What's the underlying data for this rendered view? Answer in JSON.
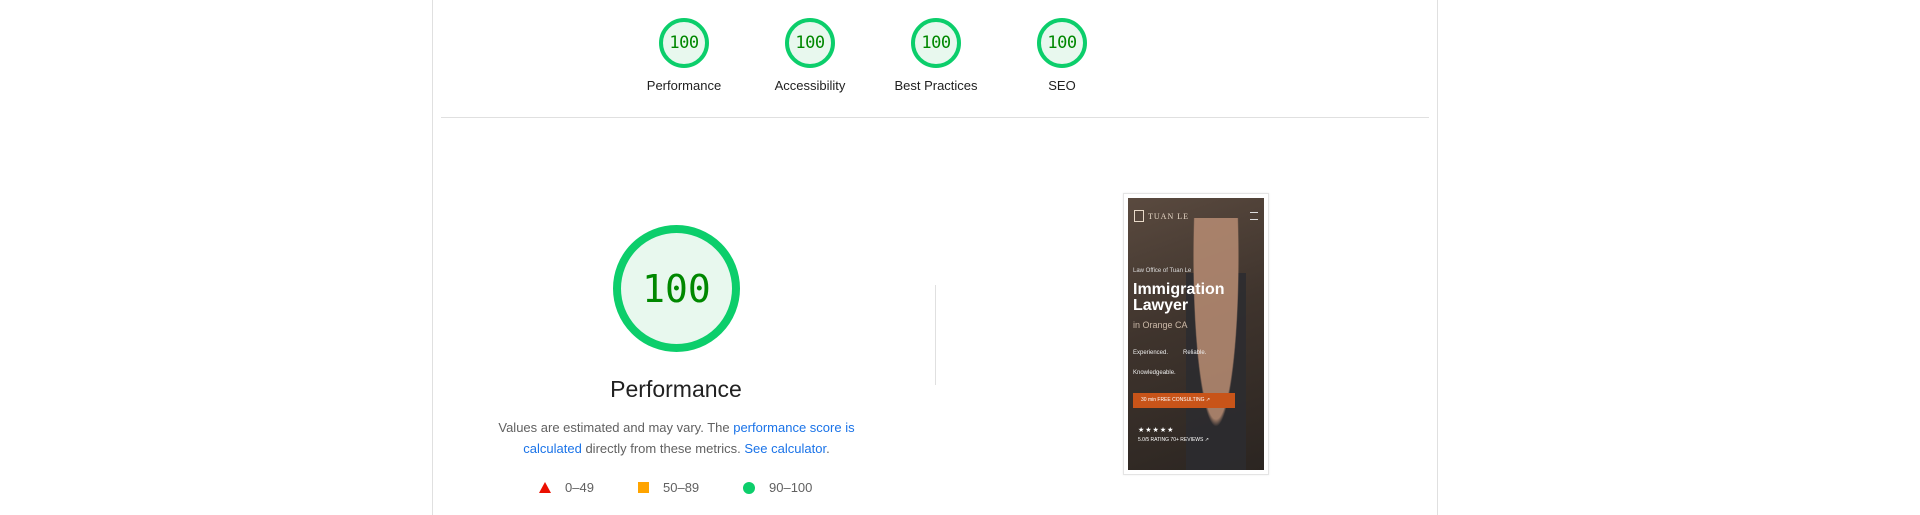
{
  "categories": [
    {
      "score": "100",
      "label": "Performance"
    },
    {
      "score": "100",
      "label": "Accessibility"
    },
    {
      "score": "100",
      "label": "Best Practices"
    },
    {
      "score": "100",
      "label": "SEO"
    }
  ],
  "performance": {
    "score": "100",
    "title": "Performance",
    "desc_prefix": "Values are estimated and may vary. The ",
    "desc_link1": "performance score is calculated",
    "desc_middle": " directly from these metrics. ",
    "desc_link2": "See calculator",
    "desc_suffix": ".",
    "legend": [
      {
        "range": "0–49",
        "color": "#eb0f00"
      },
      {
        "range": "50–89",
        "color": "#ffa400"
      },
      {
        "range": "90–100",
        "color": "#0cce6b"
      }
    ]
  },
  "screenshot": {
    "logo": "TUAN LE",
    "kicker": "Law Office of Tuan Le",
    "headline_1": "Immigration",
    "headline_2": "Lawyer",
    "subhead": "in Orange CA",
    "tags": [
      "Experienced.",
      "Reliable.",
      "Knowledgeable."
    ],
    "cta": "30 min FREE CONSULTING ↗",
    "stars": "★★★★★",
    "rating": "5.0/5 RATING  70+ REVIEWS ↗"
  },
  "colors": {
    "pass_green": "#0cce6b",
    "pass_fill": "#e8f8ee",
    "score_text": "#008800",
    "link": "#1a73e8"
  }
}
